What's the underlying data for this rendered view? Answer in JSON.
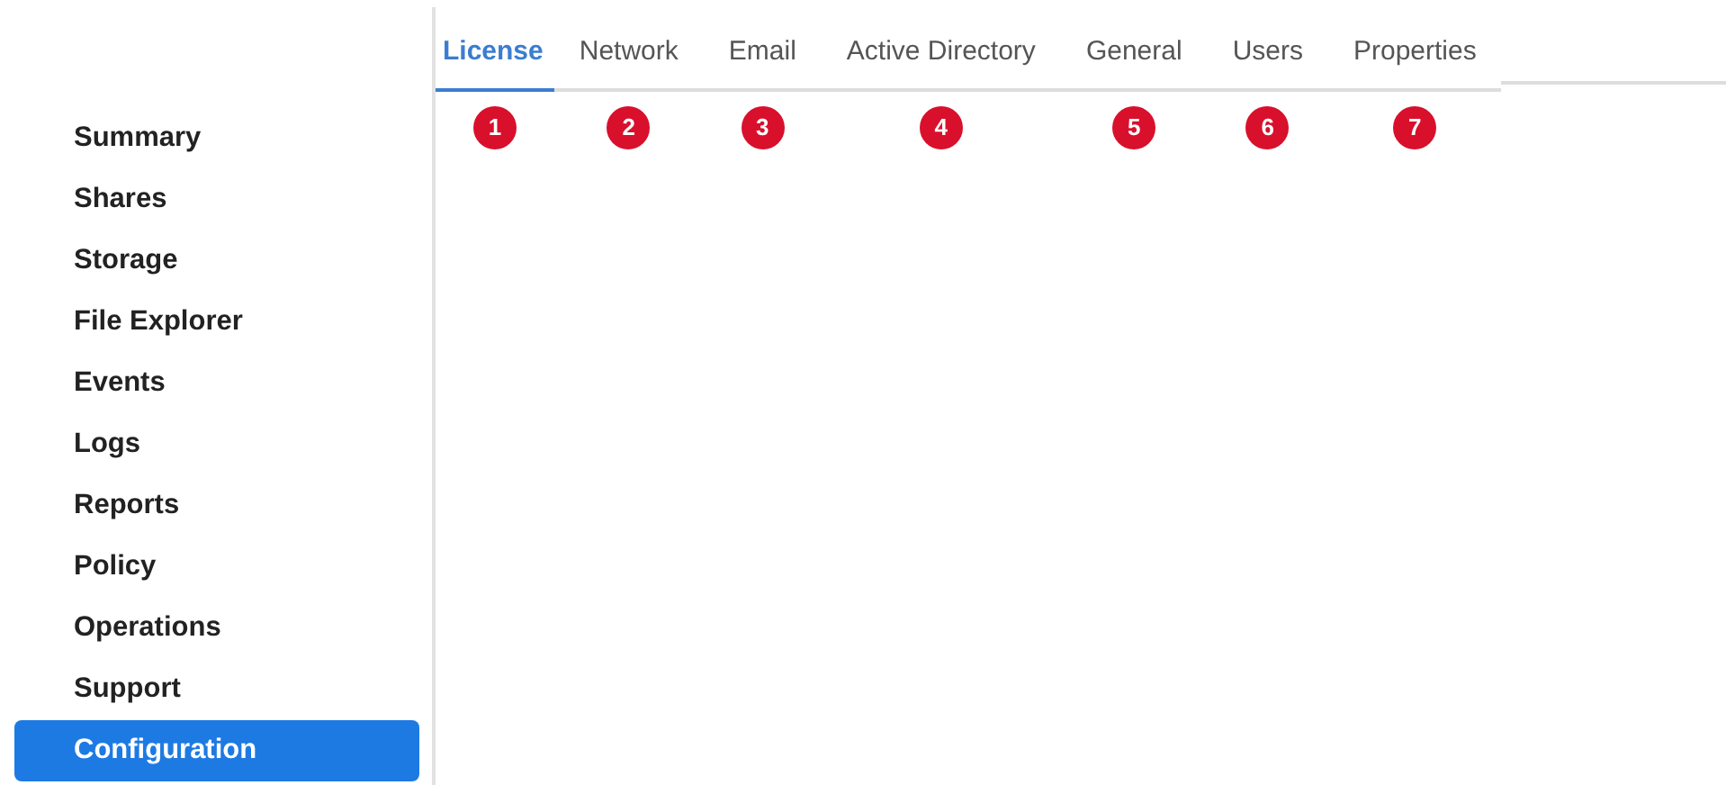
{
  "sidebar": {
    "items": [
      {
        "label": "Summary",
        "selected": false
      },
      {
        "label": "Shares",
        "selected": false
      },
      {
        "label": "Storage",
        "selected": false
      },
      {
        "label": "File Explorer",
        "selected": false
      },
      {
        "label": "Events",
        "selected": false
      },
      {
        "label": "Logs",
        "selected": false
      },
      {
        "label": "Reports",
        "selected": false
      },
      {
        "label": "Policy",
        "selected": false
      },
      {
        "label": "Operations",
        "selected": false
      },
      {
        "label": "Support",
        "selected": false
      },
      {
        "label": "Configuration",
        "selected": true
      }
    ]
  },
  "tabs": [
    {
      "label": "License",
      "selected": true,
      "badge": "1"
    },
    {
      "label": "Network",
      "selected": false,
      "badge": "2"
    },
    {
      "label": "Email",
      "selected": false,
      "badge": "3"
    },
    {
      "label": "Active Directory",
      "selected": false,
      "badge": "4"
    },
    {
      "label": "General",
      "selected": false,
      "badge": "5"
    },
    {
      "label": "Users",
      "selected": false,
      "badge": "6"
    },
    {
      "label": "Properties",
      "selected": false,
      "badge": "7"
    }
  ]
}
